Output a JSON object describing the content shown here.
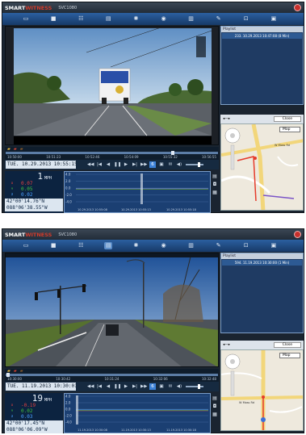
{
  "screens": [
    {
      "brand": {
        "smart": "SMART",
        "witness": "WITNESS",
        "model": "SVC1080"
      },
      "playlist": {
        "header": "Playlist",
        "row": "233. 10.29.2013 10:47:08 (8 Min)"
      },
      "map": {
        "compass_close": "Close",
        "map_type": "Map",
        "street": "W Moss Rd"
      },
      "timeline": {
        "ticks": [
          "10:50:00",
          "10:51:23",
          "10:52:46",
          "10:54:09",
          "10:55:32",
          "10:56:55"
        ]
      },
      "datetime": "TUE. 10.29.2013 10:55:15",
      "speed": {
        "value": "1",
        "unit": "MPH"
      },
      "gsensor": {
        "x": "0.07",
        "y": "0.05",
        "z": "0.02",
        "labels": [
          "X",
          "Y",
          "Z"
        ]
      },
      "gps": {
        "lat": "42°00'14.76\"N",
        "lon": "088°06'38.55\"W"
      },
      "graph": {
        "y_ticks": [
          "4.0",
          "2.0",
          "0.0",
          "-2.0",
          "-4.0"
        ],
        "x_ticks": [
          "10.29.2013 10:55:08",
          "10.29.2013 10:55:13",
          "10.29.2013 10:55:18"
        ]
      },
      "colors": {
        "x": "#e04040",
        "y": "#40c040",
        "z": "#4aa0ff"
      }
    },
    {
      "brand": {
        "smart": "SMART",
        "witness": "WITNESS",
        "model": "SVC1080"
      },
      "playlist": {
        "header": "Playlist",
        "row": "594. 11.19.2013 10:30:00 (1 Min)"
      },
      "map": {
        "compass_close": "Close",
        "map_type": "Map",
        "street": "W Moss Rd"
      },
      "timeline": {
        "ticks": [
          "10:30:00",
          "10:30:42",
          "10:31:24",
          "10:32:06",
          "10:32:48"
        ]
      },
      "datetime": "TUE. 11.19.2013 10:30:01",
      "speed": {
        "value": "19",
        "unit": "MPH"
      },
      "gsensor": {
        "x": "-0.19",
        "y": "0.02",
        "z": "0.03",
        "labels": [
          "X",
          "Y",
          "Z"
        ]
      },
      "gps": {
        "lat": "42°00'17.45\"N",
        "lon": "088°06'06.09\"W"
      },
      "graph": {
        "y_ticks": [
          "4.0",
          "2.0",
          "0.0",
          "-2.0",
          "-4.0"
        ],
        "x_ticks": [
          "11.19.2013 10:30:08",
          "11.19.2013 10:30:13",
          "11.19.2013 10:30:18"
        ]
      },
      "colors": {
        "x": "#e04040",
        "y": "#40c040",
        "z": "#4aa0ff"
      }
    }
  ]
}
